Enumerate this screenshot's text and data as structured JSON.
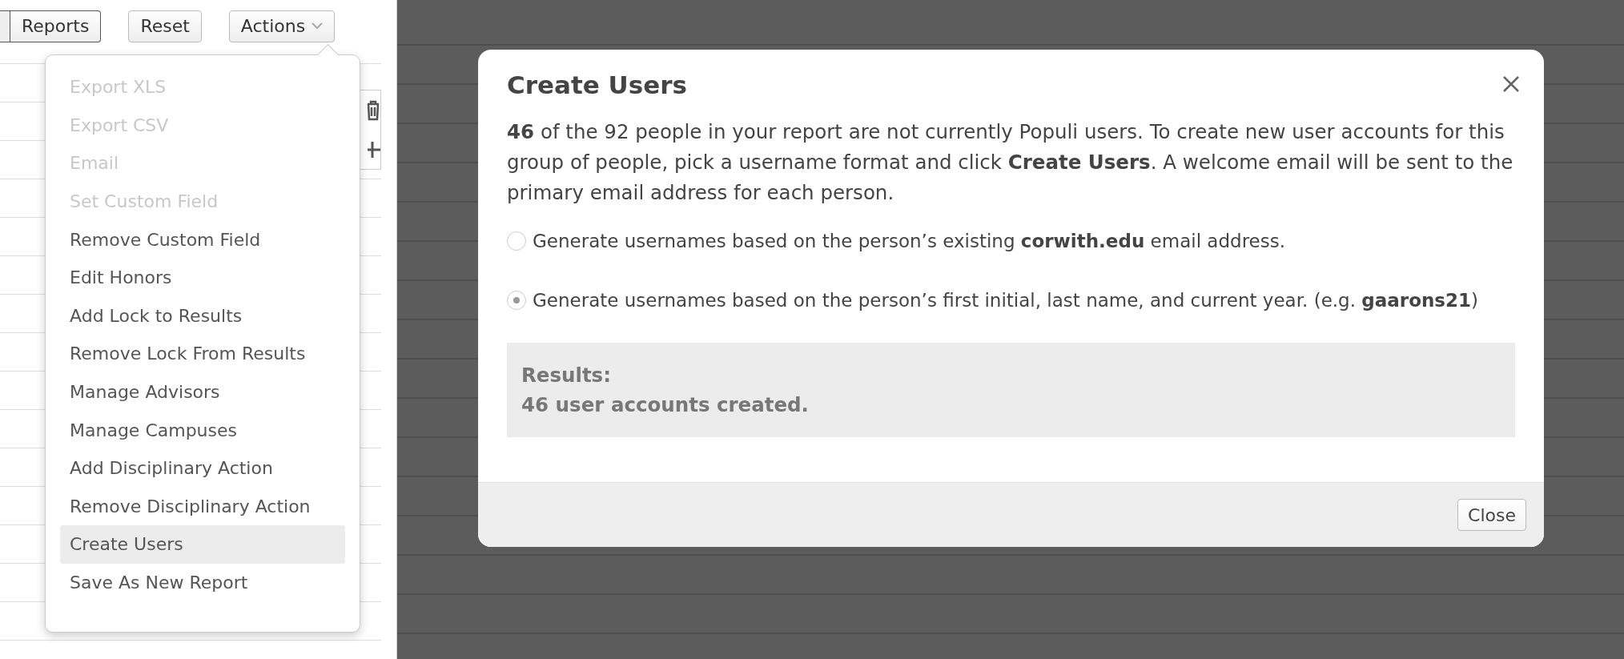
{
  "toolbar": {
    "buttons": [
      {
        "label": "Reports",
        "kind": "segment"
      },
      {
        "label": "Reset",
        "kind": "button"
      },
      {
        "label": "Actions",
        "kind": "menu"
      }
    ]
  },
  "actions_menu": {
    "items": [
      {
        "label": "Export XLS",
        "disabled": true,
        "selected": false
      },
      {
        "label": "Export CSV",
        "disabled": true,
        "selected": false
      },
      {
        "label": "Email",
        "disabled": true,
        "selected": false
      },
      {
        "label": "Set Custom Field",
        "disabled": true,
        "selected": false
      },
      {
        "label": "Remove Custom Field",
        "disabled": false,
        "selected": false
      },
      {
        "label": "Edit Honors",
        "disabled": false,
        "selected": false
      },
      {
        "label": "Add Lock to Results",
        "disabled": false,
        "selected": false
      },
      {
        "label": "Remove Lock From Results",
        "disabled": false,
        "selected": false
      },
      {
        "label": "Manage Advisors",
        "disabled": false,
        "selected": false
      },
      {
        "label": "Manage Campuses",
        "disabled": false,
        "selected": false
      },
      {
        "label": "Add Disciplinary Action",
        "disabled": false,
        "selected": false
      },
      {
        "label": "Remove Disciplinary Action",
        "disabled": false,
        "selected": false
      },
      {
        "label": "Create Users",
        "disabled": false,
        "selected": true
      },
      {
        "label": "Save As New Report",
        "disabled": false,
        "selected": false
      }
    ]
  },
  "dialog": {
    "title": "Create Users",
    "intro": "**46** of the 92 people in your report are not currently Populi users. To create new user accounts for this group of people, pick a username format and click **Create Users**. A welcome email will be sent to the primary email address for each person.",
    "options": [
      {
        "label": "Generate usernames based on the person’s existing **corwith.edu** email address.",
        "selected": false
      },
      {
        "label": "Generate usernames based on the person’s first initial, last name, and current year. (e.g. **gaarons21**)",
        "selected": true
      }
    ],
    "results": {
      "heading": "Results:",
      "message": "46 user accounts created."
    },
    "footer_button": "Close"
  }
}
